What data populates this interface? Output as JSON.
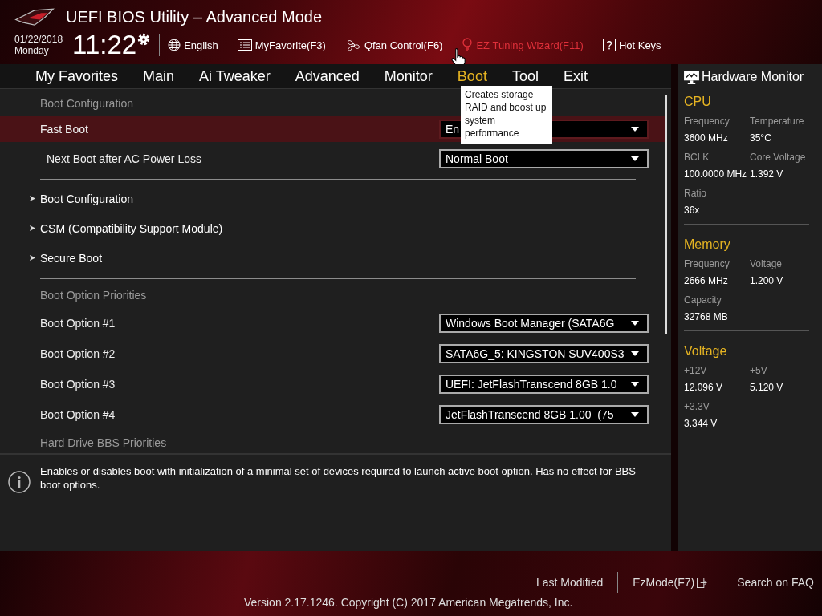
{
  "header": {
    "title": "UEFI BIOS Utility – Advanced Mode",
    "date": "01/22/2018",
    "day": "Monday",
    "time": "11:22",
    "tools": [
      {
        "label": "English",
        "hovered": false
      },
      {
        "label": "MyFavorite(F3)",
        "hovered": false
      },
      {
        "label": "Qfan Control(F6)",
        "hovered": false
      },
      {
        "label": "EZ Tuning Wizard(F11)",
        "hovered": true
      },
      {
        "label": "Hot Keys",
        "hovered": false
      }
    ]
  },
  "tabs": [
    {
      "label": "My Favorites",
      "selected": false
    },
    {
      "label": "Main",
      "selected": false
    },
    {
      "label": "Ai Tweaker",
      "selected": false
    },
    {
      "label": "Advanced",
      "selected": false
    },
    {
      "label": "Monitor",
      "selected": false
    },
    {
      "label": "Boot",
      "selected": true
    },
    {
      "label": "Tool",
      "selected": false
    },
    {
      "label": "Exit",
      "selected": false
    }
  ],
  "tooltip": "Creates storage RAID and boost up system performance",
  "settings": [
    {
      "kind": "header",
      "label": "Boot Configuration"
    },
    {
      "kind": "select",
      "label": "Fast Boot",
      "value": "En",
      "selected": true,
      "indent": false
    },
    {
      "kind": "select",
      "label": "Next Boot after AC Power Loss",
      "value": "Normal Boot",
      "selected": false,
      "indent": true
    },
    {
      "kind": "divider"
    },
    {
      "kind": "submenu",
      "label": "Boot Configuration",
      "selected": false
    },
    {
      "kind": "submenu",
      "label": "CSM (Compatibility Support Module)",
      "selected": false
    },
    {
      "kind": "submenu",
      "label": "Secure Boot",
      "selected": false
    },
    {
      "kind": "divider"
    },
    {
      "kind": "header",
      "label": "Boot Option Priorities"
    },
    {
      "kind": "select",
      "label": "Boot Option #1",
      "value": "Windows Boot Manager (SATA6G",
      "selected": false,
      "indent": false
    },
    {
      "kind": "select",
      "label": "Boot Option #2",
      "value": "SATA6G_5: KINGSTON SUV400S3",
      "selected": false,
      "indent": false
    },
    {
      "kind": "select",
      "label": "Boot Option #3",
      "value": "UEFI: JetFlashTranscend 8GB 1.0",
      "selected": false,
      "indent": false
    },
    {
      "kind": "select",
      "label": "Boot Option #4",
      "value": "JetFlashTranscend 8GB 1.00  (75",
      "selected": false,
      "indent": false
    },
    {
      "kind": "header",
      "label": "Hard Drive BBS Priorities"
    }
  ],
  "help_text": "Enables or disables boot with initialization of a minimal set of devices required to launch active boot option. Has no effect for BBS boot options.",
  "hardware_monitor": {
    "title": "Hardware Monitor",
    "sections": [
      {
        "title": "CPU",
        "fields": [
          {
            "label": "Frequency",
            "value": "3600 MHz"
          },
          {
            "label": "Temperature",
            "value": "35°C"
          },
          {
            "label": "BCLK",
            "value": "100.0000 MHz"
          },
          {
            "label": "Core Voltage",
            "value": "1.392 V"
          },
          {
            "label": "Ratio",
            "value": "36x"
          }
        ]
      },
      {
        "title": "Memory",
        "fields": [
          {
            "label": "Frequency",
            "value": "2666 MHz"
          },
          {
            "label": "Voltage",
            "value": "1.200 V"
          },
          {
            "label": "Capacity",
            "value": "32768 MB"
          }
        ]
      },
      {
        "title": "Voltage",
        "fields": [
          {
            "label": "+12V",
            "value": "12.096 V"
          },
          {
            "label": "+5V",
            "value": "5.120 V"
          },
          {
            "label": "+3.3V",
            "value": "3.344 V"
          }
        ]
      }
    ]
  },
  "footer": {
    "links": [
      "Last Modified",
      "EzMode(F7)",
      "Search on FAQ"
    ],
    "version": "Version 2.17.1246. Copyright (C) 2017 American Megatrends, Inc."
  }
}
